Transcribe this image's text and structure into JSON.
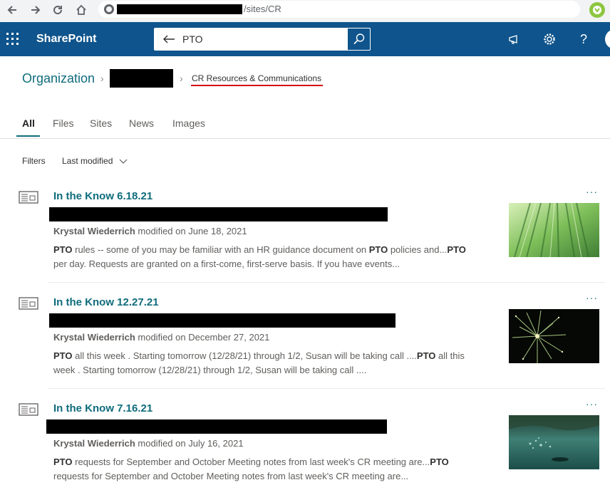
{
  "browser": {
    "url_suffix": "/sites/CR"
  },
  "suite": {
    "brand": "SharePoint",
    "search_value": "PTO",
    "help_label": "?"
  },
  "breadcrumb": {
    "root": "Organization",
    "current": "CR Resources & Communications"
  },
  "tabs": [
    {
      "label": "All"
    },
    {
      "label": "Files"
    },
    {
      "label": "Sites"
    },
    {
      "label": "News"
    },
    {
      "label": "Images"
    }
  ],
  "filters": {
    "label": "Filters",
    "sort": "Last modified"
  },
  "results": [
    {
      "title": "In the Know 6.18.21",
      "author": "Krystal Wiederrich",
      "modified": "modified on June 18, 2021",
      "snippet_line1": [
        {
          "t": "PTO",
          "b": true
        },
        {
          "t": " rules -- some of you may be familiar with an HR guidance document on ",
          "b": false
        },
        {
          "t": "PTO",
          "b": true
        },
        {
          "t": " policies and...",
          "b": false
        },
        {
          "t": "PTO",
          "b": true
        }
      ],
      "snippet_line2": [
        {
          "t": "per day. Requests are granted on a first-come, first-serve basis. If you have events...",
          "b": false
        }
      ],
      "more_label": "···"
    },
    {
      "title": "In the Know 12.27.21",
      "author": "Krystal Wiederrich",
      "modified": "modified on December 27, 2021",
      "snippet_line1": [
        {
          "t": "PTO",
          "b": true
        },
        {
          "t": " all this week . Starting tomorrow (12/28/21) through 1/2, Susan will be taking call ....",
          "b": false
        },
        {
          "t": "PTO",
          "b": true
        },
        {
          "t": " all this",
          "b": false
        }
      ],
      "snippet_line2": [
        {
          "t": "week . Starting tomorrow (12/28/21) through 1/2, Susan will be taking call ....",
          "b": false
        }
      ],
      "more_label": "···"
    },
    {
      "title": "In the Know 7.16.21",
      "author": "Krystal Wiederrich",
      "modified": "modified on July 16, 2021",
      "snippet_line1": [
        {
          "t": "PTO",
          "b": true
        },
        {
          "t": " requests for September and October Meeting notes from last week's CR meeting are...",
          "b": false
        },
        {
          "t": "PTO",
          "b": true
        }
      ],
      "snippet_line2": [
        {
          "t": "requests for September and October Meeting notes from last week's CR meeting are...",
          "b": false
        }
      ],
      "more_label": "···"
    }
  ],
  "colors": {
    "suite_bar": "#0f548c",
    "accent_teal": "#0f6c7c",
    "breadcrumb_underline": "#d40000"
  }
}
